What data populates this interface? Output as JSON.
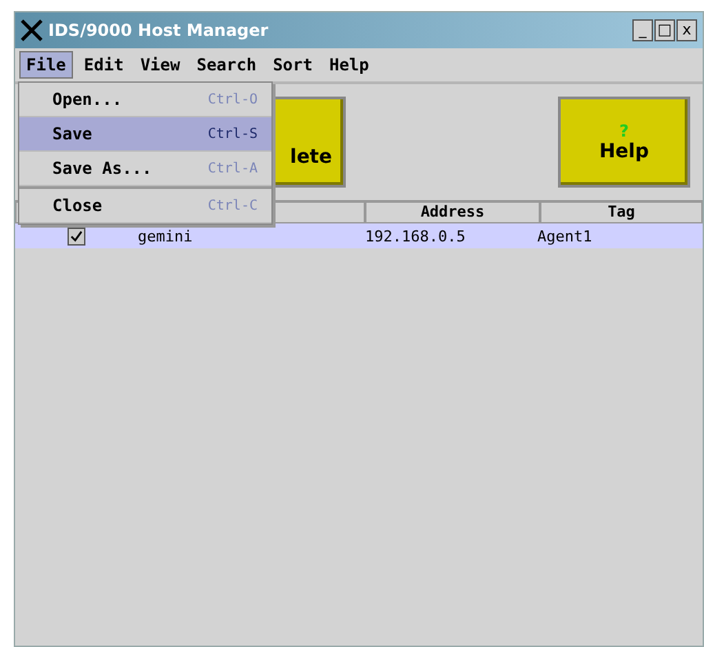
{
  "window": {
    "title": "IDS/9000 Host Manager",
    "controls": [
      "_",
      "□",
      "x"
    ]
  },
  "menubar": [
    {
      "label": "File",
      "selected": true
    },
    {
      "label": "Edit",
      "selected": false
    },
    {
      "label": "View",
      "selected": false
    },
    {
      "label": "Search",
      "selected": false
    },
    {
      "label": "Sort",
      "selected": false
    },
    {
      "label": "Help",
      "selected": false
    }
  ],
  "file_menu": [
    {
      "label": "Open...",
      "shortcut": "Ctrl-O",
      "selected": false,
      "separator_before": false
    },
    {
      "label": "Save",
      "shortcut": "Ctrl-S",
      "selected": true,
      "separator_before": false
    },
    {
      "label": "Save As...",
      "shortcut": "Ctrl-A",
      "selected": false,
      "separator_before": false
    },
    {
      "label": "Close",
      "shortcut": "Ctrl-C",
      "selected": false,
      "separator_before": true
    }
  ],
  "toolbar": [
    {
      "kind": "delete",
      "label": "lete"
    },
    {
      "kind": "help",
      "label": "Help",
      "icon": "?"
    }
  ],
  "table": {
    "columns": [
      "Address",
      "Tag"
    ],
    "rows": [
      {
        "monitored": true,
        "host": "gemini",
        "address": "192.168.0.5",
        "tag": "Agent1",
        "selected": true
      }
    ]
  }
}
